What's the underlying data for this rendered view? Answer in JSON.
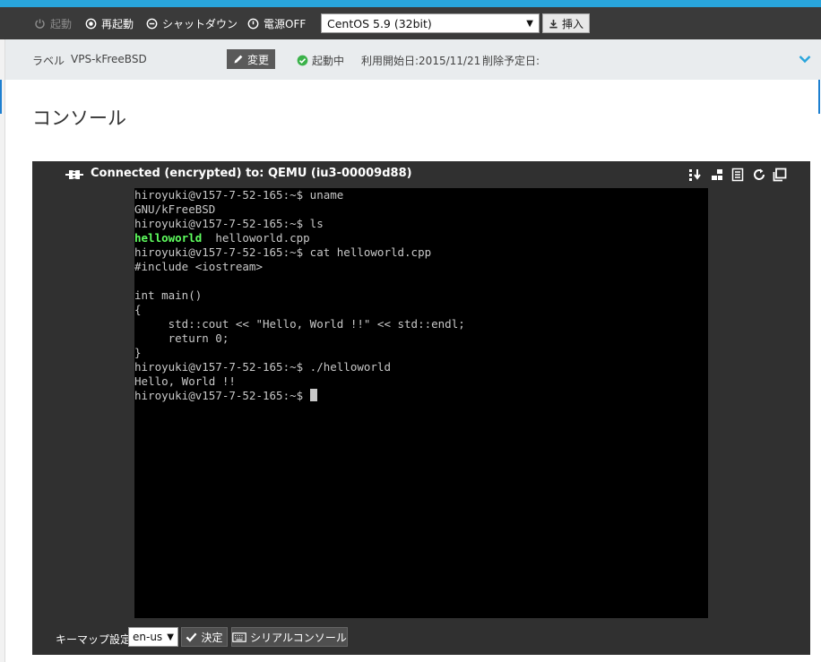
{
  "toolbar": {
    "start_label": "起動",
    "restart_label": "再起動",
    "shutdown_label": "シャットダウン",
    "power_off_label": "電源OFF",
    "os_select_value": "CentOS 5.9 (32bit)",
    "insert_label": "挿入"
  },
  "infobar": {
    "label_key": "ラベル",
    "label_value": "VPS-kFreeBSD",
    "change_label": "変更",
    "status_label": "起動中",
    "start_date": "利用開始日:2015/11/21",
    "delete_date": "削除予定日:"
  },
  "page": {
    "title": "コンソール"
  },
  "console": {
    "connection_text": "Connected (encrypted) to: QEMU (iu3-00009d88)",
    "lines": [
      "hiroyuki@v157-7-52-165:~$ uname",
      "GNU/kFreeBSD",
      "hiroyuki@v157-7-52-165:~$ ls",
      "",
      "hiroyuki@v157-7-52-165:~$ cat helloworld.cpp",
      "#include <iostream>",
      "",
      "int main()",
      "{",
      "     std::cout << \"Hello, World !!\" << std::endl;",
      "     return 0;",
      "}",
      "hiroyuki@v157-7-52-165:~$ ./helloworld",
      "Hello, World !!",
      "hiroyuki@v157-7-52-165:~$ "
    ],
    "ls_dir": "helloworld",
    "ls_file": "helloworld.cpp",
    "footer": {
      "keymap_label": "キーマップ設定",
      "keymap_value": "en-us",
      "decide_label": "決定",
      "serial_label": "シリアルコンソール"
    }
  },
  "colors": {
    "accent": "#29a5dc",
    "toolbar_bg": "#3a3a3a",
    "terminal_bg": "#000000",
    "terminal_fg": "#c8c8c8",
    "terminal_dir": "#5fff5f",
    "status_ok": "#3bb24a",
    "expand_icon": "#29a5dc"
  },
  "icons": {
    "start": "power-icon",
    "restart": "record-icon",
    "shutdown": "minus-circle-icon",
    "power_off": "power-off-icon",
    "insert": "download-icon",
    "change": "pencil-icon",
    "status": "check-circle-icon",
    "expand": "chevron-down-icon",
    "connection": "plug-icon",
    "decide": "check-icon",
    "serial": "keyboard-icon"
  }
}
